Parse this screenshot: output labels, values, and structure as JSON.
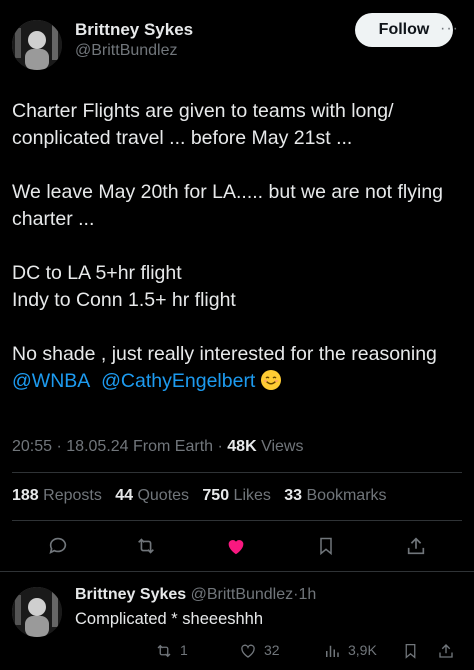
{
  "author": {
    "name": "Brittney Sykes",
    "handle": "@BrittBundlez"
  },
  "follow_label": "Follow",
  "more_label": "···",
  "tweet": {
    "lines": [
      "Charter Flights are given to teams with long/",
      "conplicated travel ... before May 21st ...",
      "We leave May 20th for LA..... but we are not flying",
      "charter ...",
      "DC to LA 5+hr flight",
      "Indy to Conn 1.5+ hr flight",
      "No shade , just really interested for the reasoning"
    ],
    "mention1": "@WNBA",
    "mention2": "@CathyEngelbert"
  },
  "meta": {
    "time": "20:55",
    "sep1": "·",
    "date": "18.05.24",
    "source": "From Earth",
    "sep2": "·",
    "views_count": "48K",
    "views_label": "Views"
  },
  "stats": {
    "reposts_count": "188",
    "reposts_label": "Reposts",
    "quotes_count": "44",
    "quotes_label": "Quotes",
    "likes_count": "750",
    "likes_label": "Likes",
    "bookmarks_count": "33",
    "bookmarks_label": "Bookmarks"
  },
  "colors": {
    "like_active": "#f91880",
    "mention": "#1d9bf0",
    "muted": "#71767b"
  },
  "reply": {
    "name": "Brittney Sykes",
    "handle": "@BrittBundlez",
    "sep": "·",
    "time": "1h",
    "text": "Complicated * sheeeshhh",
    "reposts": "1",
    "likes": "32",
    "views": "3,9K"
  },
  "icons": [
    "reply-icon",
    "repost-icon",
    "heart-icon",
    "bookmark-icon",
    "share-icon",
    "views-icon"
  ]
}
